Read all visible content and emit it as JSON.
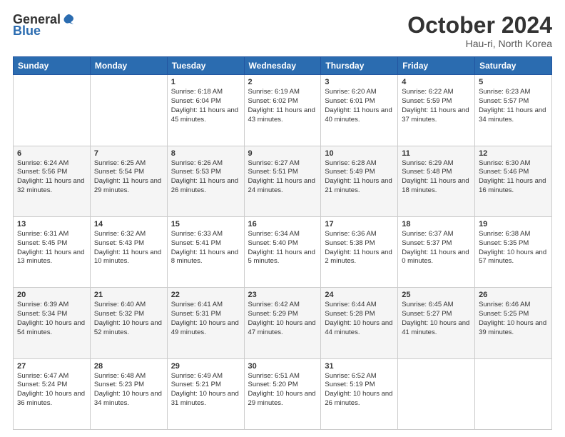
{
  "header": {
    "logo_general": "General",
    "logo_blue": "Blue",
    "month_title": "October 2024",
    "location": "Hau-ri, North Korea"
  },
  "days_of_week": [
    "Sunday",
    "Monday",
    "Tuesday",
    "Wednesday",
    "Thursday",
    "Friday",
    "Saturday"
  ],
  "weeks": [
    [
      {
        "day": "",
        "content": ""
      },
      {
        "day": "",
        "content": ""
      },
      {
        "day": "1",
        "content": "Sunrise: 6:18 AM\nSunset: 6:04 PM\nDaylight: 11 hours and 45 minutes."
      },
      {
        "day": "2",
        "content": "Sunrise: 6:19 AM\nSunset: 6:02 PM\nDaylight: 11 hours and 43 minutes."
      },
      {
        "day": "3",
        "content": "Sunrise: 6:20 AM\nSunset: 6:01 PM\nDaylight: 11 hours and 40 minutes."
      },
      {
        "day": "4",
        "content": "Sunrise: 6:22 AM\nSunset: 5:59 PM\nDaylight: 11 hours and 37 minutes."
      },
      {
        "day": "5",
        "content": "Sunrise: 6:23 AM\nSunset: 5:57 PM\nDaylight: 11 hours and 34 minutes."
      }
    ],
    [
      {
        "day": "6",
        "content": "Sunrise: 6:24 AM\nSunset: 5:56 PM\nDaylight: 11 hours and 32 minutes."
      },
      {
        "day": "7",
        "content": "Sunrise: 6:25 AM\nSunset: 5:54 PM\nDaylight: 11 hours and 29 minutes."
      },
      {
        "day": "8",
        "content": "Sunrise: 6:26 AM\nSunset: 5:53 PM\nDaylight: 11 hours and 26 minutes."
      },
      {
        "day": "9",
        "content": "Sunrise: 6:27 AM\nSunset: 5:51 PM\nDaylight: 11 hours and 24 minutes."
      },
      {
        "day": "10",
        "content": "Sunrise: 6:28 AM\nSunset: 5:49 PM\nDaylight: 11 hours and 21 minutes."
      },
      {
        "day": "11",
        "content": "Sunrise: 6:29 AM\nSunset: 5:48 PM\nDaylight: 11 hours and 18 minutes."
      },
      {
        "day": "12",
        "content": "Sunrise: 6:30 AM\nSunset: 5:46 PM\nDaylight: 11 hours and 16 minutes."
      }
    ],
    [
      {
        "day": "13",
        "content": "Sunrise: 6:31 AM\nSunset: 5:45 PM\nDaylight: 11 hours and 13 minutes."
      },
      {
        "day": "14",
        "content": "Sunrise: 6:32 AM\nSunset: 5:43 PM\nDaylight: 11 hours and 10 minutes."
      },
      {
        "day": "15",
        "content": "Sunrise: 6:33 AM\nSunset: 5:41 PM\nDaylight: 11 hours and 8 minutes."
      },
      {
        "day": "16",
        "content": "Sunrise: 6:34 AM\nSunset: 5:40 PM\nDaylight: 11 hours and 5 minutes."
      },
      {
        "day": "17",
        "content": "Sunrise: 6:36 AM\nSunset: 5:38 PM\nDaylight: 11 hours and 2 minutes."
      },
      {
        "day": "18",
        "content": "Sunrise: 6:37 AM\nSunset: 5:37 PM\nDaylight: 11 hours and 0 minutes."
      },
      {
        "day": "19",
        "content": "Sunrise: 6:38 AM\nSunset: 5:35 PM\nDaylight: 10 hours and 57 minutes."
      }
    ],
    [
      {
        "day": "20",
        "content": "Sunrise: 6:39 AM\nSunset: 5:34 PM\nDaylight: 10 hours and 54 minutes."
      },
      {
        "day": "21",
        "content": "Sunrise: 6:40 AM\nSunset: 5:32 PM\nDaylight: 10 hours and 52 minutes."
      },
      {
        "day": "22",
        "content": "Sunrise: 6:41 AM\nSunset: 5:31 PM\nDaylight: 10 hours and 49 minutes."
      },
      {
        "day": "23",
        "content": "Sunrise: 6:42 AM\nSunset: 5:29 PM\nDaylight: 10 hours and 47 minutes."
      },
      {
        "day": "24",
        "content": "Sunrise: 6:44 AM\nSunset: 5:28 PM\nDaylight: 10 hours and 44 minutes."
      },
      {
        "day": "25",
        "content": "Sunrise: 6:45 AM\nSunset: 5:27 PM\nDaylight: 10 hours and 41 minutes."
      },
      {
        "day": "26",
        "content": "Sunrise: 6:46 AM\nSunset: 5:25 PM\nDaylight: 10 hours and 39 minutes."
      }
    ],
    [
      {
        "day": "27",
        "content": "Sunrise: 6:47 AM\nSunset: 5:24 PM\nDaylight: 10 hours and 36 minutes."
      },
      {
        "day": "28",
        "content": "Sunrise: 6:48 AM\nSunset: 5:23 PM\nDaylight: 10 hours and 34 minutes."
      },
      {
        "day": "29",
        "content": "Sunrise: 6:49 AM\nSunset: 5:21 PM\nDaylight: 10 hours and 31 minutes."
      },
      {
        "day": "30",
        "content": "Sunrise: 6:51 AM\nSunset: 5:20 PM\nDaylight: 10 hours and 29 minutes."
      },
      {
        "day": "31",
        "content": "Sunrise: 6:52 AM\nSunset: 5:19 PM\nDaylight: 10 hours and 26 minutes."
      },
      {
        "day": "",
        "content": ""
      },
      {
        "day": "",
        "content": ""
      }
    ]
  ]
}
